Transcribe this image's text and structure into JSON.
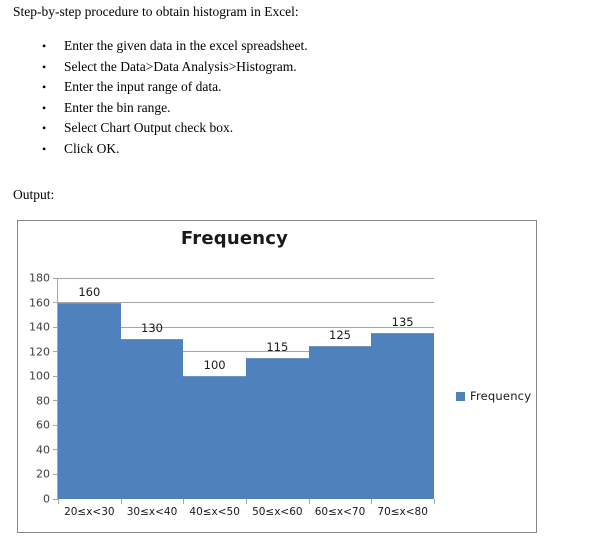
{
  "document": {
    "intro": "Step-by-step procedure to obtain histogram in Excel:",
    "steps": [
      "Enter the given data in the excel spreadsheet.",
      "Select the Data>Data Analysis>Histogram.",
      "Enter the input range of data.",
      "Enter the bin range.",
      "Select Chart Output check box.",
      "Click OK."
    ],
    "output_label": "Output:",
    "bullet_glyph": "•"
  },
  "chart_data": {
    "type": "bar",
    "title": "Frequency",
    "xlabel": "",
    "ylabel": "",
    "categories": [
      "20≤x<30",
      "30≤x<40",
      "40≤x<50",
      "50≤x<60",
      "60≤x<70",
      "70≤x<80"
    ],
    "values": [
      160,
      130,
      100,
      115,
      125,
      135
    ],
    "data_labels": [
      "160",
      "130",
      "100",
      "115",
      "125",
      "135"
    ],
    "ylim": [
      0,
      180
    ],
    "ytick_step": 20,
    "yticks": [
      "0",
      "20",
      "40",
      "60",
      "80",
      "100",
      "120",
      "140",
      "160",
      "180"
    ],
    "grid": true,
    "legend": {
      "position": "right",
      "entries": [
        {
          "name": "Frequency",
          "color": "#4F81BD"
        }
      ]
    },
    "series": [
      {
        "name": "Frequency",
        "color": "#4F81BD",
        "values": [
          160,
          130,
          100,
          115,
          125,
          135
        ]
      }
    ],
    "bar_gap": 0,
    "colors": {
      "bar": "#4F81BD",
      "gridline": "#A6A6A6",
      "axis": "#A6A6A6",
      "frame_border": "#868686",
      "text": "#1A1A1A",
      "tick_text": "#404040",
      "background": "#FFFFFF"
    }
  }
}
